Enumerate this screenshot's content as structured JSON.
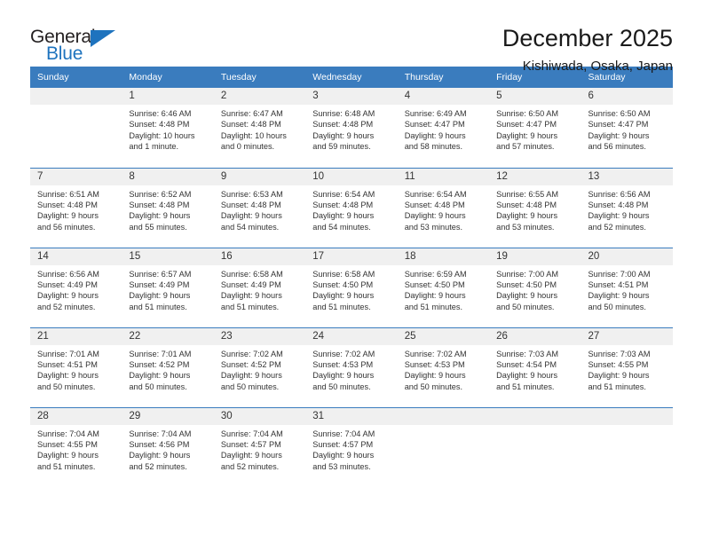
{
  "logo": {
    "word_top": "General",
    "word_bottom": "Blue",
    "triangle_icon": "triangle-icon",
    "accent_color": "#1e73be"
  },
  "header": {
    "title": "December 2025",
    "subtitle": "Kishiwada, Osaka, Japan",
    "header_bg": "#3a7cbe",
    "daynum_bg": "#f0f0f0"
  },
  "weekday_headers": [
    "Sunday",
    "Monday",
    "Tuesday",
    "Wednesday",
    "Thursday",
    "Friday",
    "Saturday"
  ],
  "weeks": [
    [
      {
        "day": "",
        "empty": true,
        "sunrise": "",
        "sunset": "",
        "daylight_1": "",
        "daylight_2": ""
      },
      {
        "day": "1",
        "sunrise": "Sunrise: 6:46 AM",
        "sunset": "Sunset: 4:48 PM",
        "daylight_1": "Daylight: 10 hours",
        "daylight_2": "and 1 minute."
      },
      {
        "day": "2",
        "sunrise": "Sunrise: 6:47 AM",
        "sunset": "Sunset: 4:48 PM",
        "daylight_1": "Daylight: 10 hours",
        "daylight_2": "and 0 minutes."
      },
      {
        "day": "3",
        "sunrise": "Sunrise: 6:48 AM",
        "sunset": "Sunset: 4:48 PM",
        "daylight_1": "Daylight: 9 hours",
        "daylight_2": "and 59 minutes."
      },
      {
        "day": "4",
        "sunrise": "Sunrise: 6:49 AM",
        "sunset": "Sunset: 4:47 PM",
        "daylight_1": "Daylight: 9 hours",
        "daylight_2": "and 58 minutes."
      },
      {
        "day": "5",
        "sunrise": "Sunrise: 6:50 AM",
        "sunset": "Sunset: 4:47 PM",
        "daylight_1": "Daylight: 9 hours",
        "daylight_2": "and 57 minutes."
      },
      {
        "day": "6",
        "sunrise": "Sunrise: 6:50 AM",
        "sunset": "Sunset: 4:47 PM",
        "daylight_1": "Daylight: 9 hours",
        "daylight_2": "and 56 minutes."
      }
    ],
    [
      {
        "day": "7",
        "sunrise": "Sunrise: 6:51 AM",
        "sunset": "Sunset: 4:48 PM",
        "daylight_1": "Daylight: 9 hours",
        "daylight_2": "and 56 minutes."
      },
      {
        "day": "8",
        "sunrise": "Sunrise: 6:52 AM",
        "sunset": "Sunset: 4:48 PM",
        "daylight_1": "Daylight: 9 hours",
        "daylight_2": "and 55 minutes."
      },
      {
        "day": "9",
        "sunrise": "Sunrise: 6:53 AM",
        "sunset": "Sunset: 4:48 PM",
        "daylight_1": "Daylight: 9 hours",
        "daylight_2": "and 54 minutes."
      },
      {
        "day": "10",
        "sunrise": "Sunrise: 6:54 AM",
        "sunset": "Sunset: 4:48 PM",
        "daylight_1": "Daylight: 9 hours",
        "daylight_2": "and 54 minutes."
      },
      {
        "day": "11",
        "sunrise": "Sunrise: 6:54 AM",
        "sunset": "Sunset: 4:48 PM",
        "daylight_1": "Daylight: 9 hours",
        "daylight_2": "and 53 minutes."
      },
      {
        "day": "12",
        "sunrise": "Sunrise: 6:55 AM",
        "sunset": "Sunset: 4:48 PM",
        "daylight_1": "Daylight: 9 hours",
        "daylight_2": "and 53 minutes."
      },
      {
        "day": "13",
        "sunrise": "Sunrise: 6:56 AM",
        "sunset": "Sunset: 4:48 PM",
        "daylight_1": "Daylight: 9 hours",
        "daylight_2": "and 52 minutes."
      }
    ],
    [
      {
        "day": "14",
        "sunrise": "Sunrise: 6:56 AM",
        "sunset": "Sunset: 4:49 PM",
        "daylight_1": "Daylight: 9 hours",
        "daylight_2": "and 52 minutes."
      },
      {
        "day": "15",
        "sunrise": "Sunrise: 6:57 AM",
        "sunset": "Sunset: 4:49 PM",
        "daylight_1": "Daylight: 9 hours",
        "daylight_2": "and 51 minutes."
      },
      {
        "day": "16",
        "sunrise": "Sunrise: 6:58 AM",
        "sunset": "Sunset: 4:49 PM",
        "daylight_1": "Daylight: 9 hours",
        "daylight_2": "and 51 minutes."
      },
      {
        "day": "17",
        "sunrise": "Sunrise: 6:58 AM",
        "sunset": "Sunset: 4:50 PM",
        "daylight_1": "Daylight: 9 hours",
        "daylight_2": "and 51 minutes."
      },
      {
        "day": "18",
        "sunrise": "Sunrise: 6:59 AM",
        "sunset": "Sunset: 4:50 PM",
        "daylight_1": "Daylight: 9 hours",
        "daylight_2": "and 51 minutes."
      },
      {
        "day": "19",
        "sunrise": "Sunrise: 7:00 AM",
        "sunset": "Sunset: 4:50 PM",
        "daylight_1": "Daylight: 9 hours",
        "daylight_2": "and 50 minutes."
      },
      {
        "day": "20",
        "sunrise": "Sunrise: 7:00 AM",
        "sunset": "Sunset: 4:51 PM",
        "daylight_1": "Daylight: 9 hours",
        "daylight_2": "and 50 minutes."
      }
    ],
    [
      {
        "day": "21",
        "sunrise": "Sunrise: 7:01 AM",
        "sunset": "Sunset: 4:51 PM",
        "daylight_1": "Daylight: 9 hours",
        "daylight_2": "and 50 minutes."
      },
      {
        "day": "22",
        "sunrise": "Sunrise: 7:01 AM",
        "sunset": "Sunset: 4:52 PM",
        "daylight_1": "Daylight: 9 hours",
        "daylight_2": "and 50 minutes."
      },
      {
        "day": "23",
        "sunrise": "Sunrise: 7:02 AM",
        "sunset": "Sunset: 4:52 PM",
        "daylight_1": "Daylight: 9 hours",
        "daylight_2": "and 50 minutes."
      },
      {
        "day": "24",
        "sunrise": "Sunrise: 7:02 AM",
        "sunset": "Sunset: 4:53 PM",
        "daylight_1": "Daylight: 9 hours",
        "daylight_2": "and 50 minutes."
      },
      {
        "day": "25",
        "sunrise": "Sunrise: 7:02 AM",
        "sunset": "Sunset: 4:53 PM",
        "daylight_1": "Daylight: 9 hours",
        "daylight_2": "and 50 minutes."
      },
      {
        "day": "26",
        "sunrise": "Sunrise: 7:03 AM",
        "sunset": "Sunset: 4:54 PM",
        "daylight_1": "Daylight: 9 hours",
        "daylight_2": "and 51 minutes."
      },
      {
        "day": "27",
        "sunrise": "Sunrise: 7:03 AM",
        "sunset": "Sunset: 4:55 PM",
        "daylight_1": "Daylight: 9 hours",
        "daylight_2": "and 51 minutes."
      }
    ],
    [
      {
        "day": "28",
        "sunrise": "Sunrise: 7:04 AM",
        "sunset": "Sunset: 4:55 PM",
        "daylight_1": "Daylight: 9 hours",
        "daylight_2": "and 51 minutes."
      },
      {
        "day": "29",
        "sunrise": "Sunrise: 7:04 AM",
        "sunset": "Sunset: 4:56 PM",
        "daylight_1": "Daylight: 9 hours",
        "daylight_2": "and 52 minutes."
      },
      {
        "day": "30",
        "sunrise": "Sunrise: 7:04 AM",
        "sunset": "Sunset: 4:57 PM",
        "daylight_1": "Daylight: 9 hours",
        "daylight_2": "and 52 minutes."
      },
      {
        "day": "31",
        "sunrise": "Sunrise: 7:04 AM",
        "sunset": "Sunset: 4:57 PM",
        "daylight_1": "Daylight: 9 hours",
        "daylight_2": "and 53 minutes."
      },
      {
        "day": "",
        "empty": true,
        "sunrise": "",
        "sunset": "",
        "daylight_1": "",
        "daylight_2": ""
      },
      {
        "day": "",
        "empty": true,
        "sunrise": "",
        "sunset": "",
        "daylight_1": "",
        "daylight_2": ""
      },
      {
        "day": "",
        "empty": true,
        "sunrise": "",
        "sunset": "",
        "daylight_1": "",
        "daylight_2": ""
      }
    ]
  ]
}
